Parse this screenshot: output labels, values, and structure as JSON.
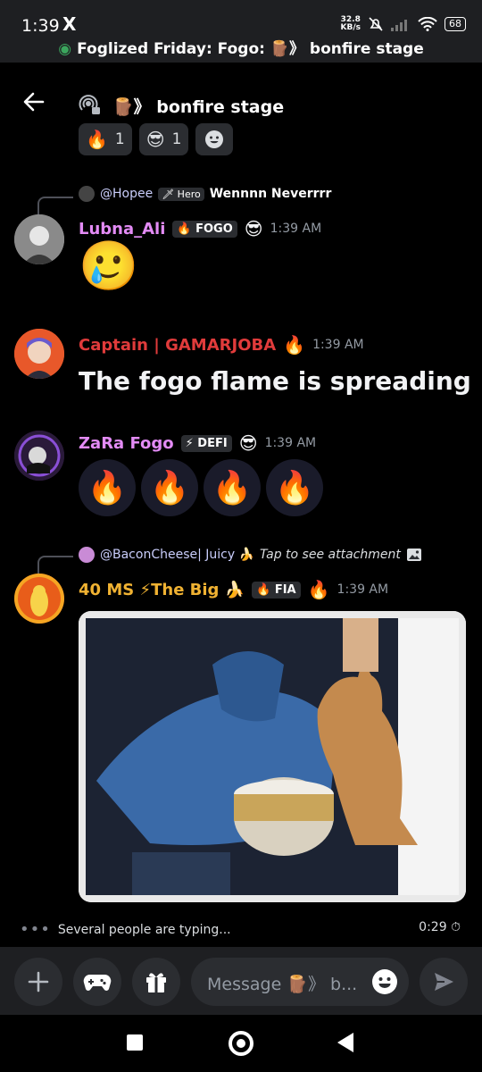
{
  "status_bar": {
    "time": "1:39",
    "x_icon": "X",
    "speed_value": "32.8",
    "speed_unit": "KB/s",
    "battery": "68",
    "notification": "Foglized Friday: Fogo: 🪵》 bonfire stage"
  },
  "header": {
    "channel_title": "🪵》 bonfire stage"
  },
  "reactions": [
    {
      "emoji": "🔥",
      "count": "1"
    },
    {
      "emoji": "😎",
      "count": "1"
    }
  ],
  "messages": [
    {
      "reply": {
        "name": "@Hopee",
        "tag": "🗡 Hero",
        "text": "Wennnn Neverrrr"
      },
      "username": "Lubna_Ali",
      "username_color": "#e38bf5",
      "badge": "🔥 FOGO",
      "badge_emoji": "😎",
      "timestamp": "1:39 AM",
      "content_emoji": "🥲"
    },
    {
      "username": "Captain | GAMARJOBA",
      "username_color": "#e03b3b",
      "badge_emoji": "🔥",
      "timestamp": "1:39 AM",
      "text": "The fogo flame is spreading"
    },
    {
      "username": "ZaRa Fogo",
      "username_color": "#e38bf5",
      "badge": "⚡ DEFI",
      "badge_emoji": "😎",
      "timestamp": "1:39 AM",
      "emotes": [
        "🔥",
        "🔥",
        "🔥",
        "🔥"
      ]
    },
    {
      "reply": {
        "name": "@BaconCheese| Juicy 🍌",
        "text": "Tap to see attachment"
      },
      "username": "40 MS ⚡The Big 🍌",
      "username_color": "#f0b232",
      "badge": "🔥 FIA",
      "badge_emoji": "🔥",
      "timestamp": "1:39 AM"
    }
  ],
  "typing": {
    "text": "Several people are typing...",
    "slowmode": "0:29"
  },
  "composer": {
    "placeholder": "Message 🪵》 b..."
  },
  "colors": {
    "background": "#000000",
    "surface": "#2b2d31",
    "composer_bg": "#1e1f22",
    "muted": "#949ba4",
    "stage_green": "#3ba55d"
  }
}
